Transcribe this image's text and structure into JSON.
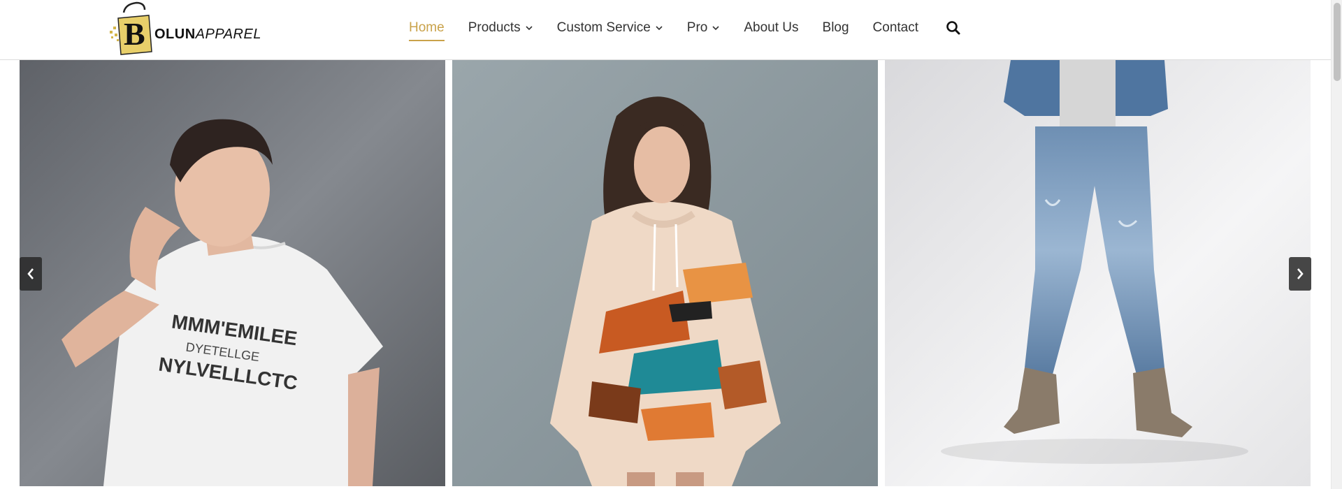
{
  "brand": {
    "logo_letter": "B",
    "name_bold": "OLUN",
    "name_rest": "APPAREL",
    "accent": "#c9a24a"
  },
  "nav": {
    "items": [
      {
        "label": "Home",
        "active": true,
        "dropdown": false
      },
      {
        "label": "Products",
        "active": false,
        "dropdown": true
      },
      {
        "label": "Custom Service",
        "active": false,
        "dropdown": true
      },
      {
        "label": "Pro",
        "active": false,
        "dropdown": true
      },
      {
        "label": "About Us",
        "active": false,
        "dropdown": false
      },
      {
        "label": "Blog",
        "active": false,
        "dropdown": false
      },
      {
        "label": "Contact",
        "active": false,
        "dropdown": false
      }
    ],
    "search_icon": "search-icon"
  },
  "slider": {
    "slides": [
      {
        "subject": "man-white-tshirt",
        "shirt_print": [
          "MMM'EMILEE",
          "DYETELLGE",
          "NYLVELLLCTC"
        ]
      },
      {
        "subject": "woman-painted-hoodie"
      },
      {
        "subject": "man-denim-jeans"
      }
    ],
    "prev_icon": "chevron-left-icon",
    "next_icon": "chevron-right-icon"
  }
}
